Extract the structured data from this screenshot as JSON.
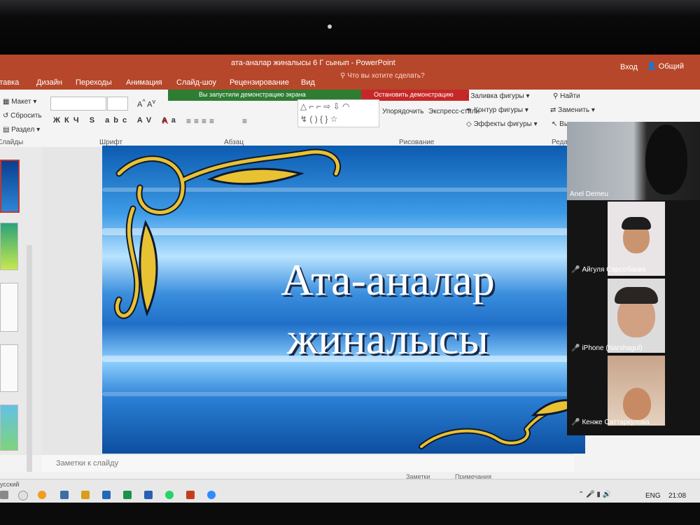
{
  "window": {
    "title": "ата-аналар жиналысы 6 Г  сынып - PowerPoint",
    "login": "Вход",
    "share": "Общий дост"
  },
  "ribbon_tabs": [
    {
      "label": "вставка"
    },
    {
      "label": "Дизайн"
    },
    {
      "label": "Переходы"
    },
    {
      "label": "Анимация"
    },
    {
      "label": "Слайд-шоу"
    },
    {
      "label": "Рецензирование"
    },
    {
      "label": "Вид"
    }
  ],
  "tell_me": "Что вы хотите сделать?",
  "screen_share": {
    "status": "Вы запустили демонстрацию экрана",
    "stop_label": "Остановить демонстрацию"
  },
  "ribbon": {
    "slides": {
      "layout": "Макет",
      "reset": "Сбросить",
      "section": "Раздел",
      "group": "Слайды"
    },
    "font": {
      "group": "Шрифт"
    },
    "paragraph": {
      "group": "Абзац"
    },
    "drawing": {
      "arrange": "Упорядочить",
      "express_styles": "Экспресс-стили",
      "fill": "Заливка фигуры",
      "outline": "Контур фигуры",
      "effects": "Эффекты фигуры",
      "group": "Рисование"
    },
    "editing": {
      "find": "Найти",
      "replace": "Заменить",
      "select": "Выделить",
      "group": "Реда"
    }
  },
  "slide": {
    "title_line1": "Ата-аналар",
    "title_line2": "жиналысы"
  },
  "notes_placeholder": "Заметки к слайду",
  "status_bar": {
    "notes": "Заметки",
    "comments": "Примечания"
  },
  "taskbar": {
    "lang": "ENG",
    "time": "21:08",
    "input_lang": "усский"
  },
  "participants": [
    {
      "name": "Anel Demeu",
      "muted": false
    },
    {
      "name": "Айгуля Сарсебаева",
      "muted": true
    },
    {
      "name": "iPhone (Narshagul)",
      "muted": true
    },
    {
      "name": "Кенже Саттаркулова",
      "muted": true
    }
  ],
  "colors": {
    "accent": "#b7472a",
    "share_green": "#2e7d32",
    "stop_red": "#c62828"
  }
}
